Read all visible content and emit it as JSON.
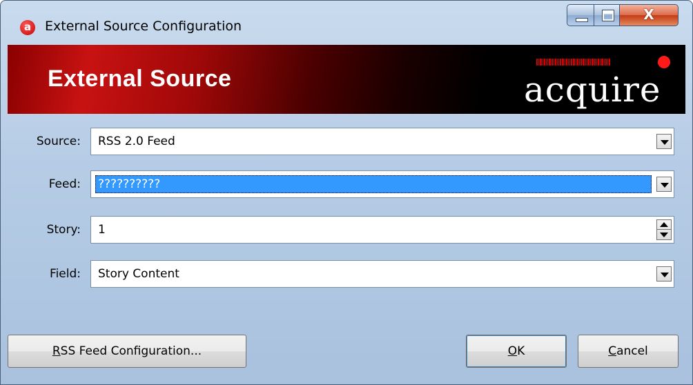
{
  "window": {
    "title": "External Source Configuration",
    "app_icon_glyph": "a",
    "controls": [
      "minimize",
      "maximize",
      "close"
    ],
    "close_glyph": "X"
  },
  "banner": {
    "heading": "External Source",
    "logo_text": "acquire",
    "colors": {
      "red": "#c81212",
      "dark": "#000000",
      "logo_red": "#ff1a1a"
    }
  },
  "form": {
    "source": {
      "label": "Source:",
      "value": "RSS 2.0 Feed"
    },
    "feed": {
      "label": "Feed:",
      "value": "??????????"
    },
    "story": {
      "label": "Story:",
      "value": "1"
    },
    "field": {
      "label": "Field:",
      "value": "Story Content"
    }
  },
  "buttons": {
    "rss_config": {
      "mnemonic": "R",
      "rest": "SS Feed Configuration..."
    },
    "ok": {
      "mnemonic": "O",
      "rest": "K"
    },
    "cancel": {
      "mnemonic": "C",
      "rest": "ancel"
    }
  },
  "icons": {
    "app": "acquire-logo-icon",
    "dropdown": "chevron-down-icon",
    "spin_up": "chevron-up-icon",
    "spin_down": "chevron-down-icon"
  },
  "colors": {
    "selection": "#3399ff",
    "window_frame": "#b7cde6"
  }
}
